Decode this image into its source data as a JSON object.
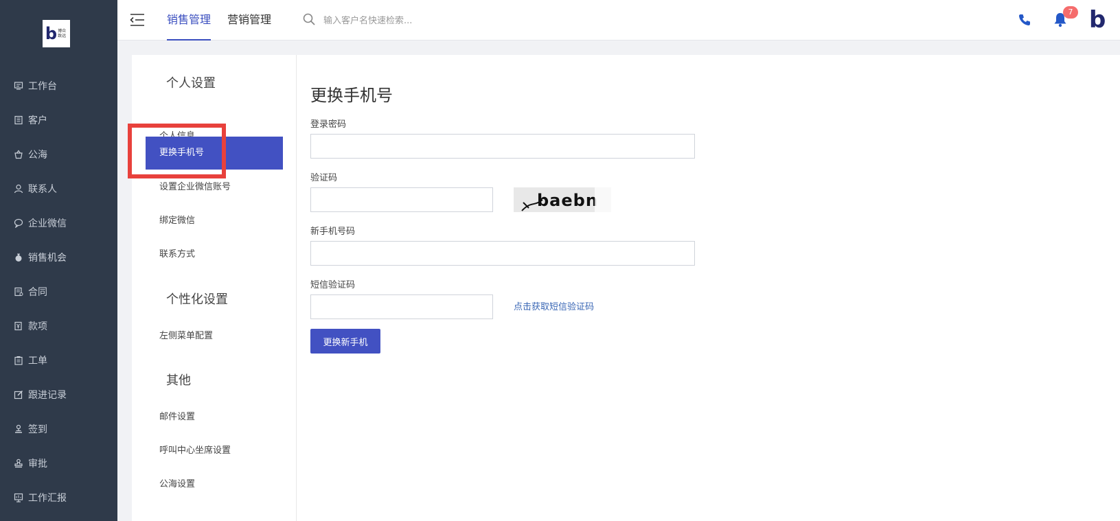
{
  "brand": {
    "logo_text": "博众致远",
    "logo_letter": "b"
  },
  "sidebar": {
    "items": [
      {
        "label": "工作台",
        "icon": "monitor-icon"
      },
      {
        "label": "客户",
        "icon": "building-icon"
      },
      {
        "label": "公海",
        "icon": "basket-icon"
      },
      {
        "label": "联系人",
        "icon": "user-icon"
      },
      {
        "label": "企业微信",
        "icon": "chat-icon"
      },
      {
        "label": "销售机会",
        "icon": "money-bag-icon"
      },
      {
        "label": "合同",
        "icon": "contract-icon"
      },
      {
        "label": "款项",
        "icon": "yen-doc-icon"
      },
      {
        "label": "工单",
        "icon": "clipboard-icon"
      },
      {
        "label": "跟进记录",
        "icon": "edit-icon"
      },
      {
        "label": "签到",
        "icon": "checkin-icon"
      },
      {
        "label": "审批",
        "icon": "stamp-icon"
      },
      {
        "label": "工作汇报",
        "icon": "report-icon"
      }
    ]
  },
  "header": {
    "tabs": [
      {
        "label": "销售管理",
        "active": true
      },
      {
        "label": "营销管理",
        "active": false
      }
    ],
    "search_placeholder": "输入客户名快速检索...",
    "notification_count": "7"
  },
  "settings_nav": {
    "sections": [
      {
        "title": "个人设置",
        "items": [
          "个人信息",
          "更换手机号",
          "设置企业微信账号",
          "绑定微信",
          "联系方式"
        ]
      },
      {
        "title": "个性化设置",
        "items": [
          "左侧菜单配置"
        ]
      },
      {
        "title": "其他",
        "items": [
          "邮件设置",
          "呼叫中心坐席设置",
          "公海设置"
        ]
      }
    ],
    "active_item": "更换手机号"
  },
  "form": {
    "title": "更换手机号",
    "password_label": "登录密码",
    "password_value": "",
    "captcha_label": "验证码",
    "captcha_value": "",
    "captcha_text": "baebn",
    "new_phone_label": "新手机号码",
    "new_phone_value": "",
    "sms_label": "短信验证码",
    "sms_value": "",
    "sms_link": "点击获取短信验证码",
    "submit_label": "更换新手机"
  },
  "colors": {
    "sidebar_bg": "#2f3a4a",
    "accent": "#4251c2",
    "link": "#3a67b5",
    "badge": "#f56c6c",
    "highlight": "#e8413c"
  }
}
